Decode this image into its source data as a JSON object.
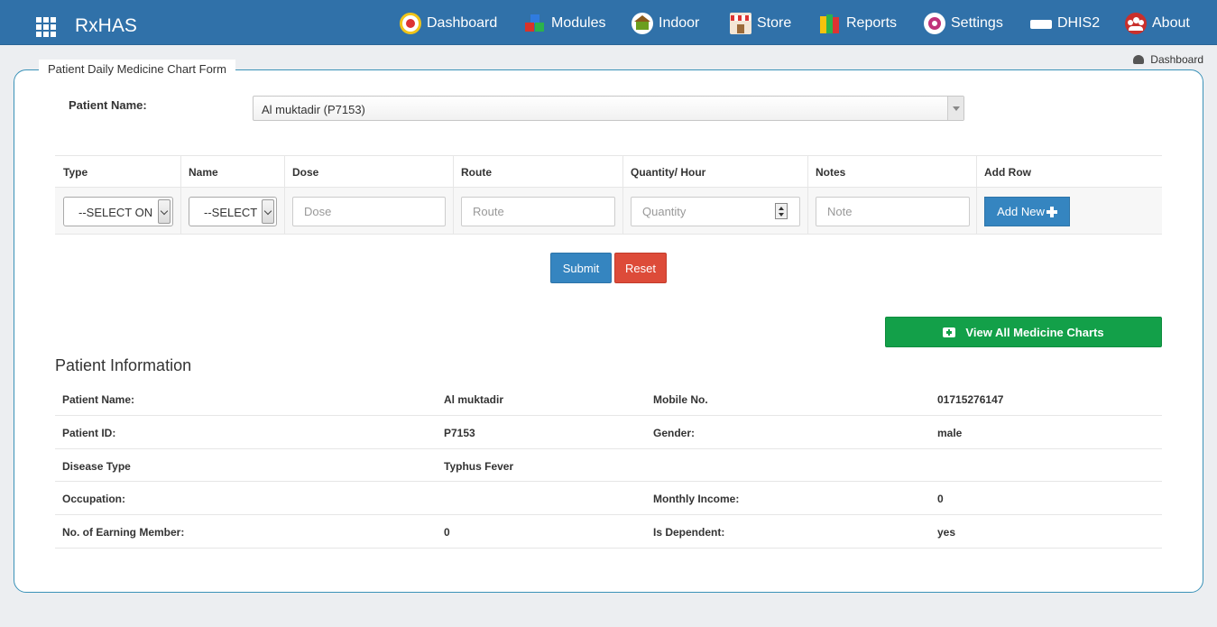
{
  "nav": {
    "brand": "RxHAS",
    "items": [
      {
        "label": "Dashboard",
        "icon": "dashboard-gauge-icon"
      },
      {
        "label": "Modules",
        "icon": "modules-cubes-icon"
      },
      {
        "label": "Indoor",
        "icon": "indoor-house-icon"
      },
      {
        "label": "Store",
        "icon": "store-building-icon"
      },
      {
        "label": "Reports",
        "icon": "reports-books-icon"
      },
      {
        "label": "Settings",
        "icon": "settings-gear-icon"
      },
      {
        "label": "DHIS2",
        "icon": "dhis2-logo-icon"
      },
      {
        "label": "About",
        "icon": "about-people-icon"
      }
    ]
  },
  "breadcrumb": {
    "label": "Dashboard",
    "icon": "dashboard-icon"
  },
  "form": {
    "legend": "Patient Daily Medicine Chart Form",
    "patient_label": "Patient Name:",
    "patient_value": "Al muktadir (P7153)"
  },
  "table": {
    "headers": [
      "Type",
      "Name",
      "Dose",
      "Route",
      "Quantity/ Hour",
      "Notes",
      "Add Row"
    ],
    "type_select": "--SELECT ON",
    "name_select": "--SELECT",
    "dose_placeholder": "Dose",
    "route_placeholder": "Route",
    "quantity_placeholder": "Quantity",
    "note_placeholder": "Note",
    "add_new_label": "Add New"
  },
  "buttons": {
    "submit": "Submit",
    "reset": "Reset",
    "view_all": "View All Medicine Charts"
  },
  "patient_info": {
    "title": "Patient Information",
    "rows": [
      {
        "l1": "Patient Name:",
        "v1": "Al muktadir",
        "l2": "Mobile No.",
        "v2": "01715276147"
      },
      {
        "l1": "Patient ID:",
        "v1": "P7153",
        "l2": "Gender:",
        "v2": "male"
      },
      {
        "l1": "Disease Type",
        "v1": "Typhus Fever",
        "l2": "",
        "v2": ""
      },
      {
        "l1": "Occupation:",
        "v1": "",
        "l2": "Monthly Income:",
        "v2": "0"
      },
      {
        "l1": "No. of Earning Member:",
        "v1": "0",
        "l2": "Is Dependent:",
        "v2": "yes"
      }
    ]
  },
  "colors": {
    "navbar": "#3071a9",
    "primary": "#3585c0",
    "danger": "#dd4b39",
    "success": "#13a049"
  }
}
